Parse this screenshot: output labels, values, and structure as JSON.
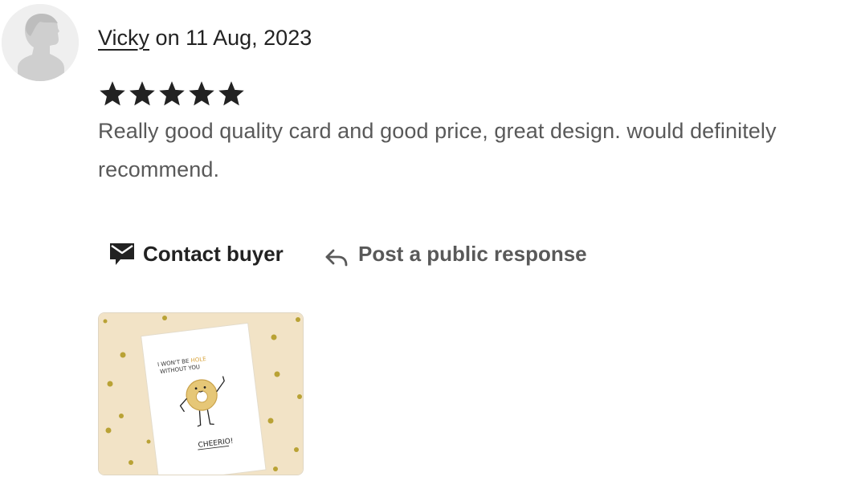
{
  "review": {
    "reviewer_name": "Vicky",
    "date_text": "on 11 Aug, 2023",
    "rating": 5,
    "rating_max": 5,
    "text": "Really good quality card and good price, great design. would definitely recommend."
  },
  "actions": {
    "contact_label": "Contact buyer",
    "contact_icon": "mail-icon",
    "respond_label": "Post a public response",
    "respond_icon": "reply-arrow-icon"
  },
  "photo": {
    "card_line1_a": "I WON'T BE ",
    "card_line1_b": "HOLE",
    "card_line2": "WITHOUT YOU",
    "card_footer": "CHEERIO!"
  },
  "colors": {
    "text_primary": "#222222",
    "text_secondary": "#595959",
    "star": "#222222",
    "photo_background": "#f2e3c6",
    "dot_gold": "#b9a235"
  }
}
